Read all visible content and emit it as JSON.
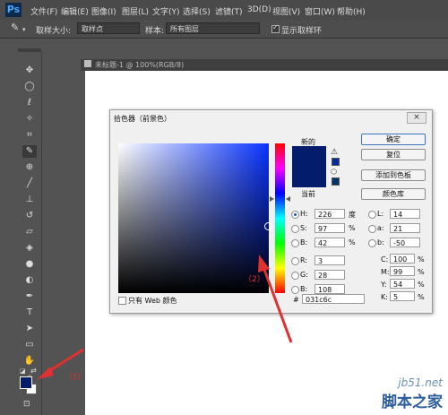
{
  "app": {
    "logo": "Ps"
  },
  "menubar": {
    "items": [
      "文件(F)",
      "编辑(E)",
      "图像(I)",
      "图层(L)",
      "文字(Y)",
      "选择(S)",
      "滤镜(T)",
      "3D(D)",
      "视图(V)",
      "窗口(W)",
      "帮助(H)"
    ]
  },
  "options": {
    "sample_size_label": "取样大小:",
    "sample_size_value": "取样点",
    "sample_label": "样本:",
    "sample_value": "所有图层",
    "show_ring_label": "显示取样环"
  },
  "document": {
    "tab_label": "未标题-1 @ 100%(RGB/8)"
  },
  "dialog": {
    "title": "拾色器（前景色）",
    "close_label": "×",
    "new_label": "新的",
    "current_label": "当前",
    "new_color": "#031c6c",
    "current_color": "#031c6c",
    "only_web_label": "只有 Web 颜色",
    "buttons": {
      "ok": "确定",
      "reset": "复位",
      "add_swatch": "添加到色板",
      "libraries": "颜色库"
    },
    "hsb": {
      "h_label": "H:",
      "h_value": "226",
      "h_unit": "度",
      "s_label": "S:",
      "s_value": "97",
      "s_unit": "%",
      "b_label": "B:",
      "b_value": "42",
      "b_unit": "%"
    },
    "rgb": {
      "r_label": "R:",
      "r_value": "3",
      "g_label": "G:",
      "g_value": "28",
      "b_label": "B:",
      "b_value": "108"
    },
    "lab": {
      "l_label": "L:",
      "l_value": "14",
      "a_label": "a:",
      "a_value": "21",
      "b_label": "b:",
      "b_value": "-50"
    },
    "cmyk": {
      "c_label": "C:",
      "c_value": "100",
      "m_label": "M:",
      "m_value": "99",
      "y_label": "Y:",
      "y_value": "54",
      "k_label": "K:",
      "k_value": "5",
      "unit": "%"
    },
    "hex_label": "#",
    "hex_value": "031c6c"
  },
  "annotations": {
    "label_1": "（1）",
    "label_2": "（2）",
    "color": "#e03030"
  },
  "toolbox": {
    "foreground": "#031c6c",
    "background": "#ffffff"
  },
  "watermark": {
    "line1": "jb51.net",
    "line2": "脚本之家"
  }
}
